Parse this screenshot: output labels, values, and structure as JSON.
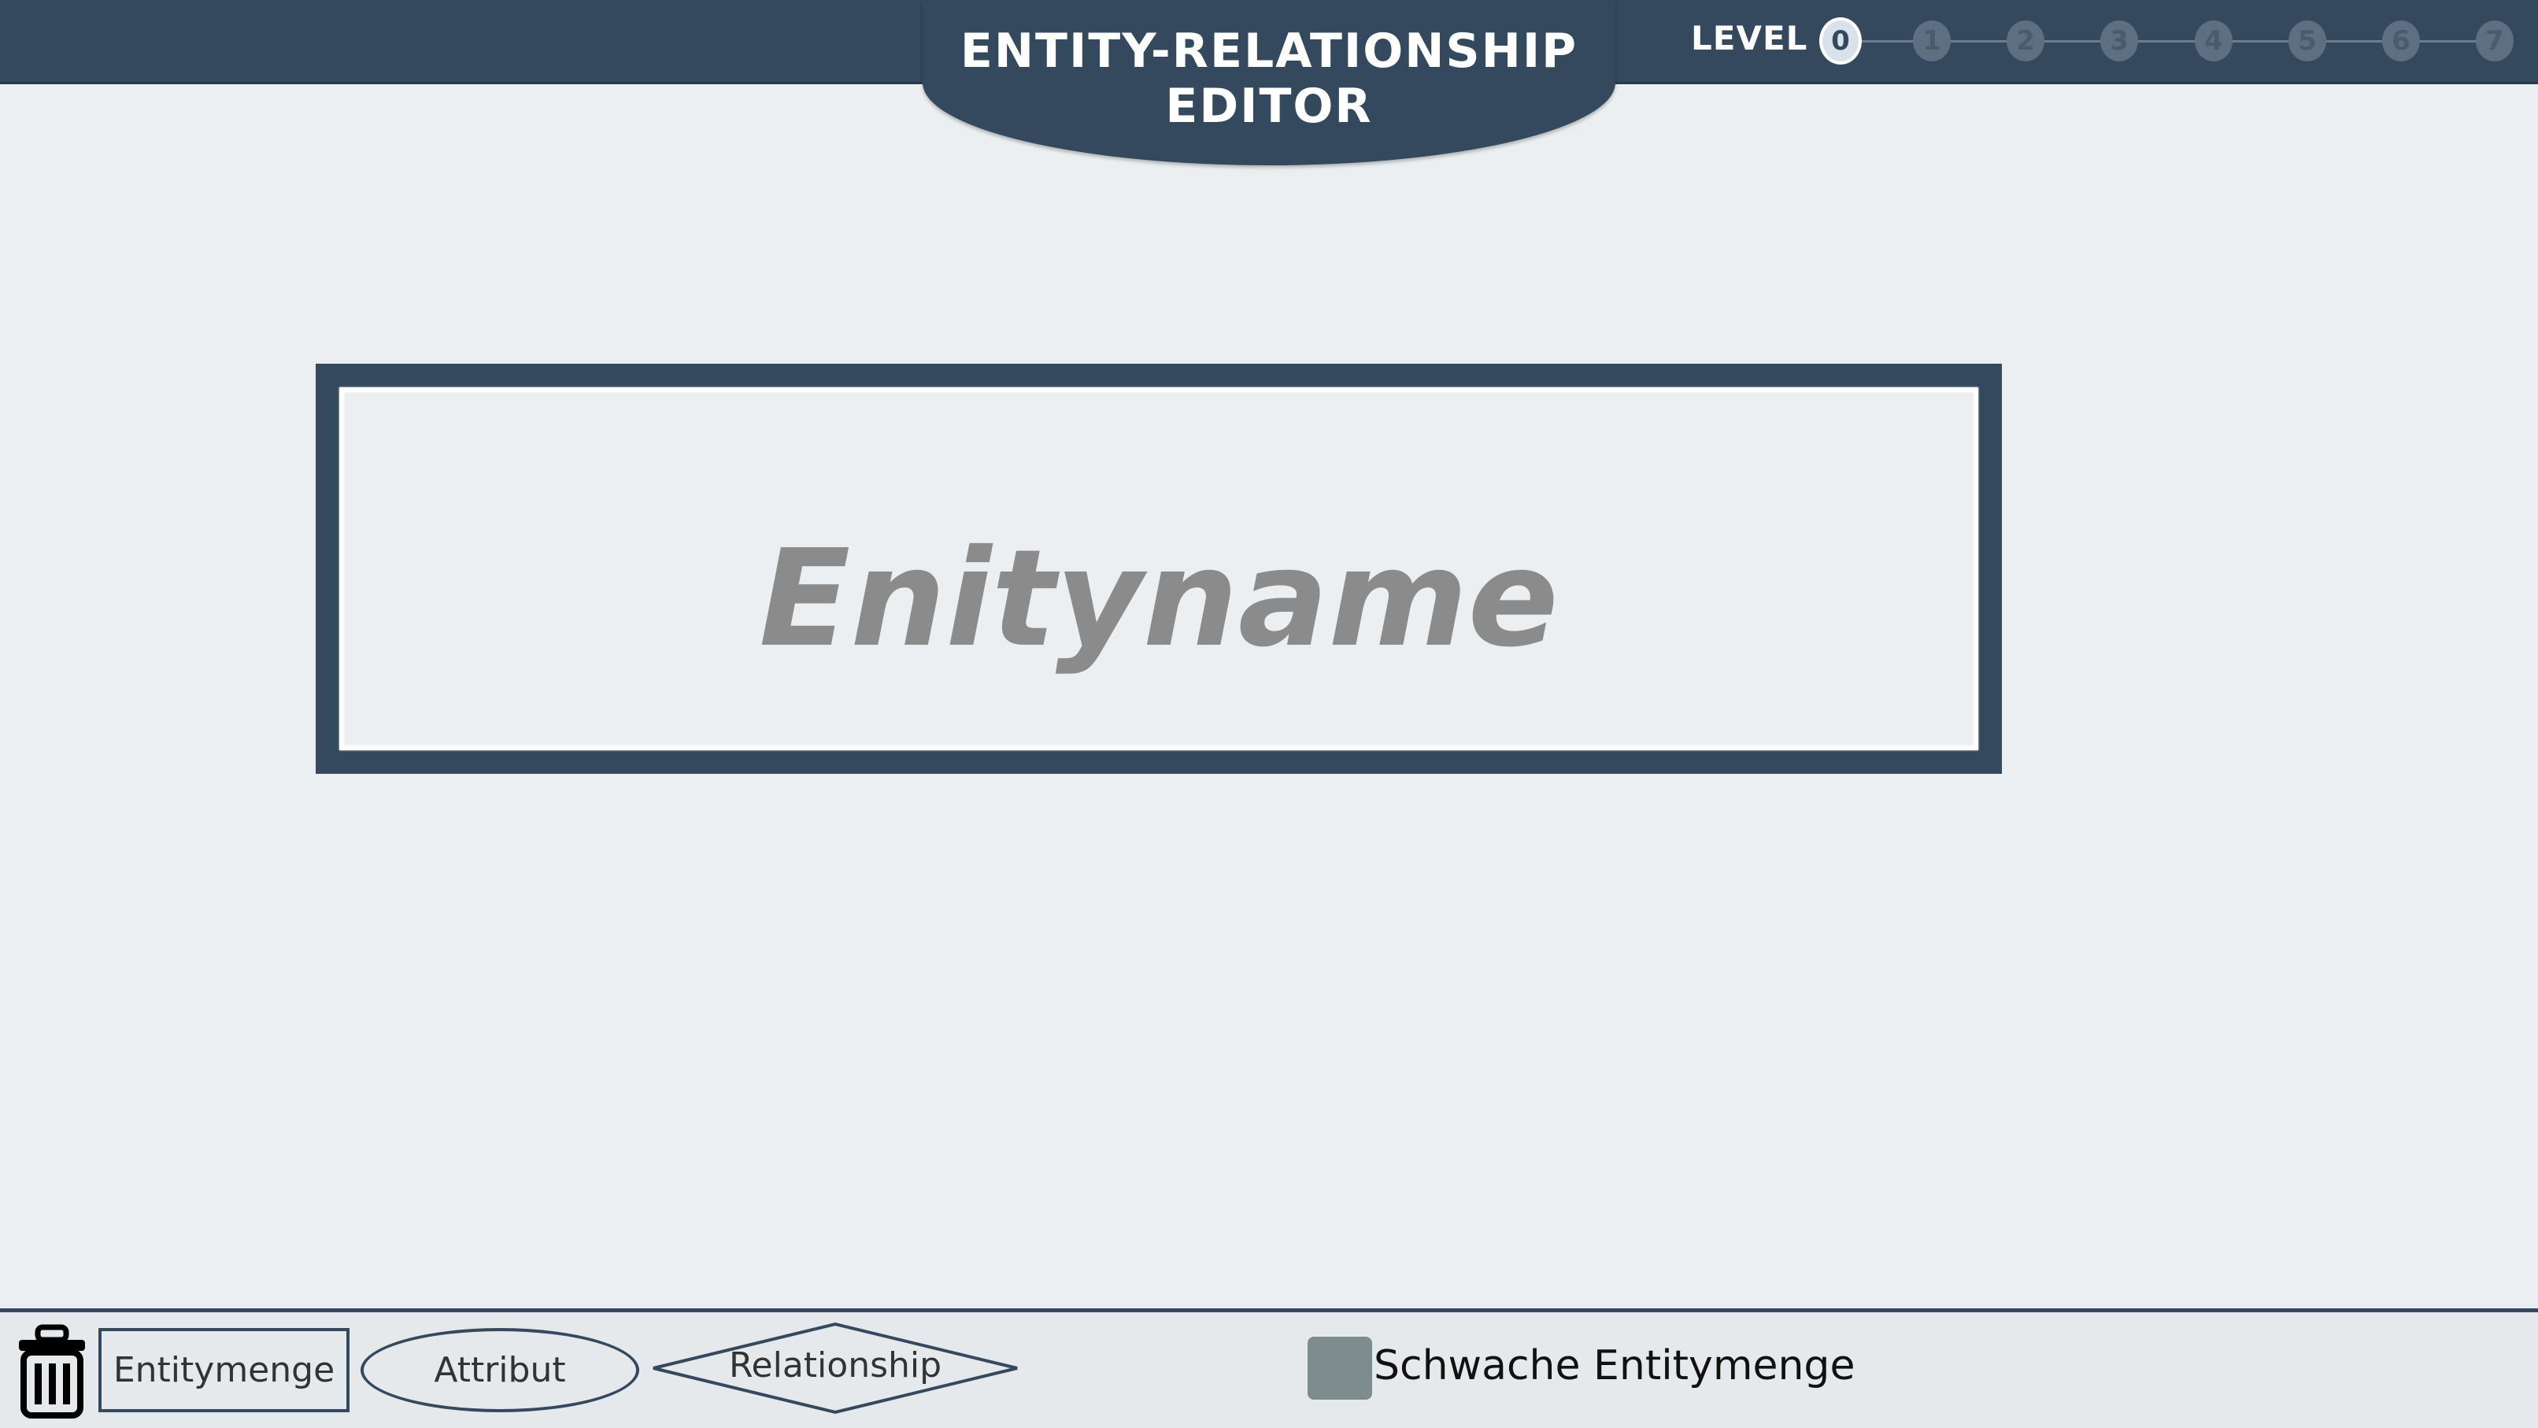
{
  "header": {
    "title_line1": "ENTITY-RELATIONSHIP",
    "title_line2": "EDITOR",
    "level_label": "LEVEL",
    "levels": [
      "0",
      "1",
      "2",
      "3",
      "4",
      "5",
      "6",
      "7"
    ],
    "active_level": "0"
  },
  "canvas": {
    "entity_name": "Enityname"
  },
  "toolbar": {
    "trash_icon": "trash-icon",
    "entity_label": "Entitymenge",
    "attribute_label": "Attribut",
    "relationship_label": "Relationship",
    "weak_entity_label": "Schwache Entitymenge",
    "weak_entity_checked": false
  },
  "colors": {
    "primary": "#34495e",
    "background": "#eceff1",
    "checkbox": "#7f8c8d"
  }
}
